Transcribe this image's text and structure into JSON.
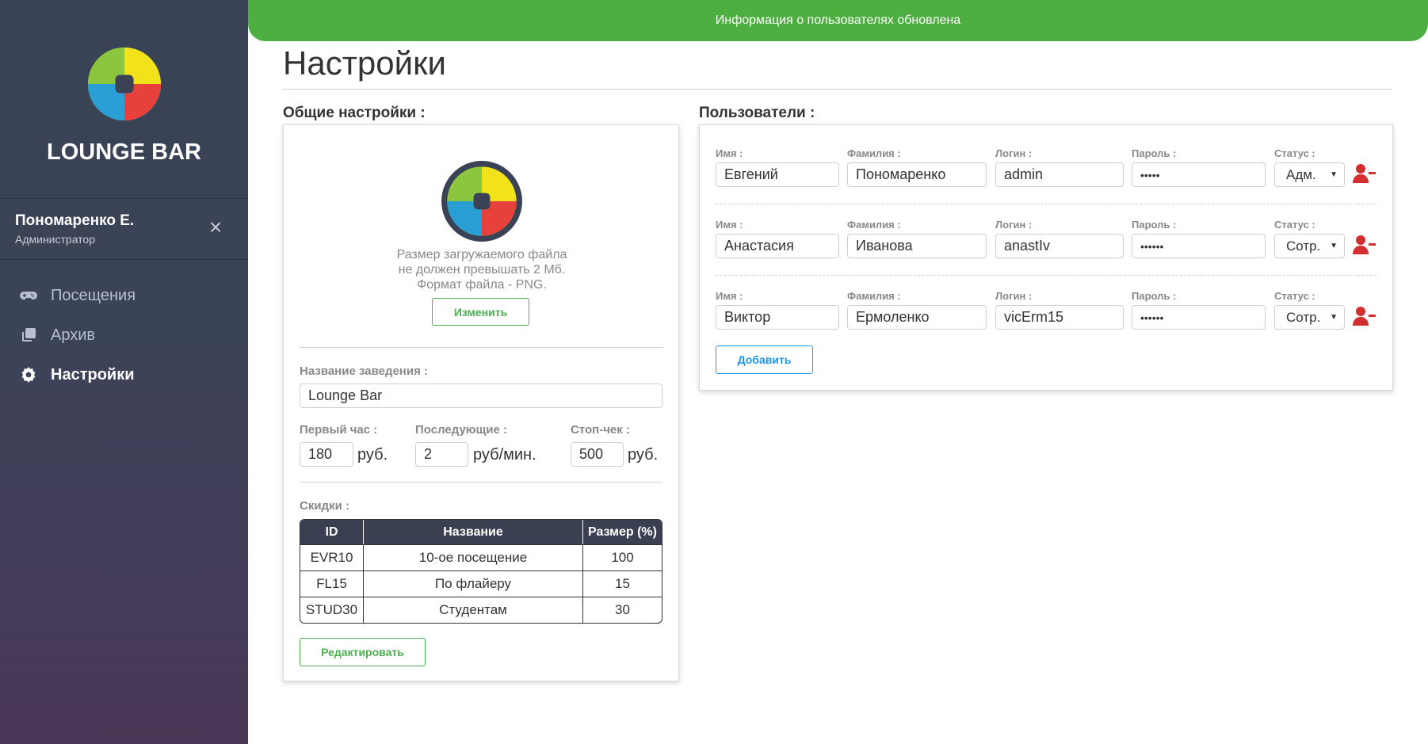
{
  "toast": {
    "message": "Информация о пользователях обновлена"
  },
  "sidebar": {
    "brand": "LOUNGE BAR",
    "user": {
      "name": "Пономаренко Е.",
      "role": "Администратор",
      "close_icon": "×"
    },
    "nav": [
      {
        "label": "Посещения",
        "icon": "gamepad-icon",
        "active": false
      },
      {
        "label": "Архив",
        "icon": "copy-icon",
        "active": false
      },
      {
        "label": "Настройки",
        "icon": "gear-icon",
        "active": true
      }
    ]
  },
  "page": {
    "title": "Настройки"
  },
  "general": {
    "section_title": "Общие настройки :",
    "logo_hint_lines": [
      "Размер загружаемого файла",
      "не должен превышать 2 Мб.",
      "Формат файла - PNG."
    ],
    "change_button": "Изменить",
    "venue_label": "Название заведения :",
    "venue_value": "Lounge Bar",
    "first_hour_label": "Первый час :",
    "first_hour_value": "180",
    "first_hour_unit": "руб.",
    "next_label": "Последующие :",
    "next_value": "2",
    "next_unit": "руб/мин.",
    "stop_label": "Стоп-чек :",
    "stop_value": "500",
    "stop_unit": "руб.",
    "discounts_label": "Скидки :",
    "discounts_headers": [
      "ID",
      "Название",
      "Размер (%)"
    ],
    "discounts": [
      {
        "id": "EVR10",
        "name": "10-ое посещение",
        "size": "100"
      },
      {
        "id": "FL15",
        "name": "По флайеру",
        "size": "15"
      },
      {
        "id": "STUD30",
        "name": "Студентам",
        "size": "30"
      }
    ],
    "edit_button": "Редактировать"
  },
  "users": {
    "section_title": "Пользователи :",
    "labels": {
      "first_name": "Имя :",
      "last_name": "Фамилия :",
      "login": "Логин :",
      "password": "Пароль :",
      "status": "Статус :"
    },
    "rows": [
      {
        "first_name": "Евгений",
        "last_name": "Пономаренко",
        "login": "admin",
        "password": "•••••",
        "status": "Адм."
      },
      {
        "first_name": "Анастасия",
        "last_name": "Иванова",
        "login": "anastIv",
        "password": "••••••",
        "status": "Сотр."
      },
      {
        "first_name": "Виктор",
        "last_name": "Ермоленко",
        "login": "vicErm15",
        "password": "••••••",
        "status": "Сотр."
      }
    ],
    "add_button": "Добавить"
  },
  "colors": {
    "accent_green": "#4caf3f",
    "accent_blue": "#2196f3",
    "danger": "#d32f2f",
    "sidebar": "#3a4255"
  }
}
